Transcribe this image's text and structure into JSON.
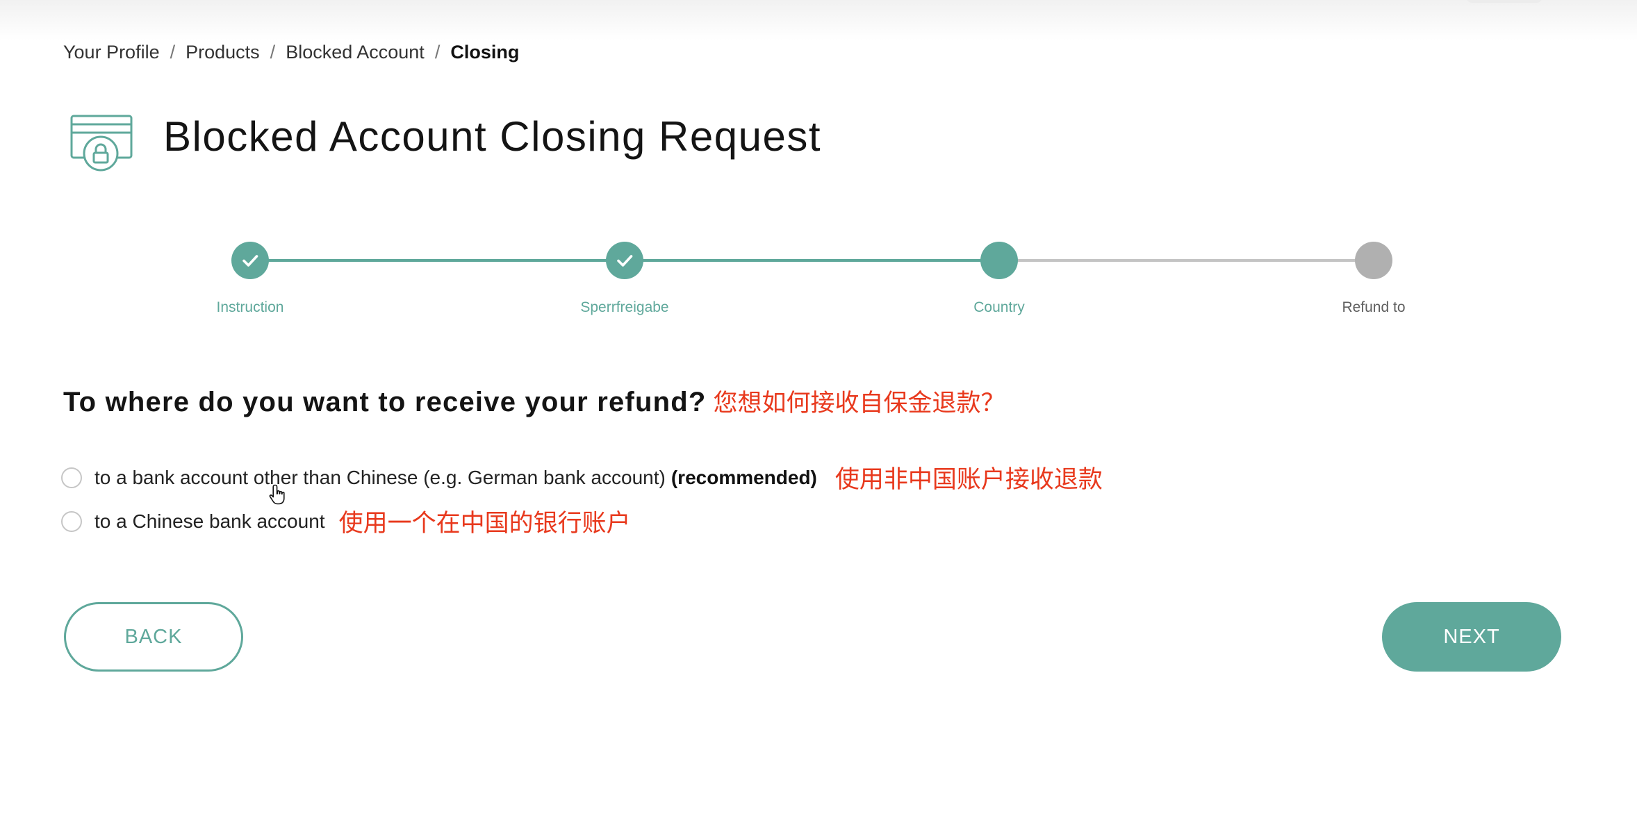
{
  "breadcrumb": {
    "items": [
      "Your Profile",
      "Products",
      "Blocked Account"
    ],
    "current": "Closing",
    "separator": "/"
  },
  "header": {
    "title": "Blocked Account Closing Request",
    "icon": "card-lock-icon"
  },
  "stepper": {
    "steps": [
      {
        "label": "Instruction",
        "state": "done"
      },
      {
        "label": "Sperrfreigabe",
        "state": "done"
      },
      {
        "label": "Country",
        "state": "active"
      },
      {
        "label": "Refund to",
        "state": "todo"
      }
    ]
  },
  "question": {
    "text": "To where do you want to receive your refund?",
    "annotation": "您想如何接收自保金退款？"
  },
  "options": [
    {
      "text": "to a bank account other than Chinese (e.g. German bank account)",
      "strong": "(recommended)",
      "annotation": "使用非中国账户接收退款",
      "selected": false
    },
    {
      "text": "to a Chinese bank account",
      "annotation": "使用一个在中国的银行账户",
      "selected": false
    }
  ],
  "actions": {
    "back_label": "BACK",
    "next_label": "NEXT"
  },
  "colors": {
    "accent": "#5fa89b",
    "inactive": "#b0b0b0",
    "annotation": "#e8391d"
  }
}
